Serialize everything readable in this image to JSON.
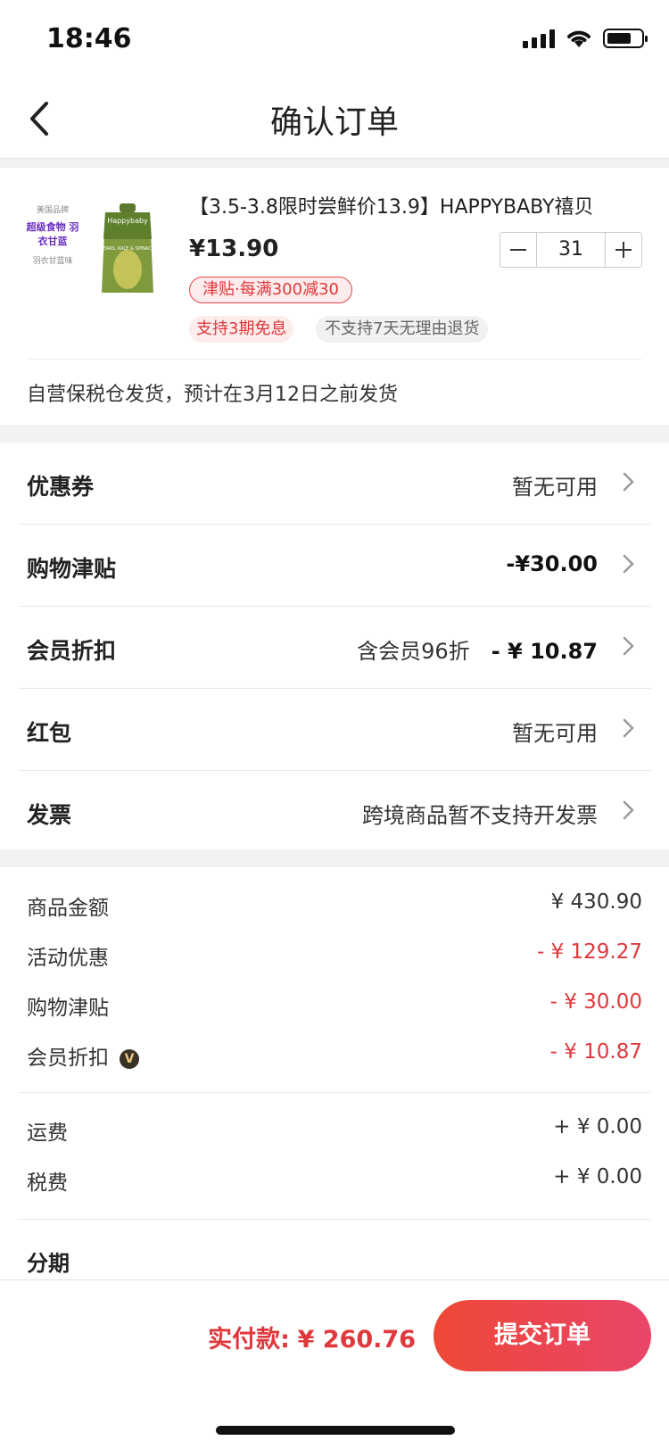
{
  "status_bar": {
    "time": "18:46"
  },
  "nav": {
    "title": "确认订单"
  },
  "product": {
    "image_label_1": "美国品牌",
    "image_label_2": "超级食物 羽衣甘蓝",
    "image_label_3": "羽衣甘蓝味",
    "pouch_brand": "Happybaby",
    "pouch_text": "PEARS, KALE & SPINACH",
    "name": "【3.5-3.8限时尝鲜价13.9】HAPPYBABY禧贝",
    "price": "¥13.90",
    "quantity": "31",
    "subsidy_badge": "津贴·每满300减30",
    "installment_tag": "支持3期免息",
    "return_tag": "不支持7天无理由退货",
    "shipping_note": "自营保税仓发货，预计在3月12日之前发货"
  },
  "options": [
    {
      "label": "优惠券",
      "value": "暂无可用"
    },
    {
      "label": "购物津贴",
      "value": "-¥30.00"
    },
    {
      "label": "会员折扣",
      "sub": "含会员96折",
      "value": "- ¥ 10.87"
    },
    {
      "label": "红包",
      "value": "暂无可用"
    },
    {
      "label": "发票",
      "value": "跨境商品暂不支持开发票"
    }
  ],
  "summary": {
    "goods_amount": {
      "label": "商品金额",
      "value": "¥ 430.90"
    },
    "promotion": {
      "label": "活动优惠",
      "value": "- ¥ 129.27"
    },
    "subsidy": {
      "label": "购物津贴",
      "value": "- ¥ 30.00"
    },
    "member_discount": {
      "label": "会员折扣",
      "value": "- ¥ 10.87",
      "vip_icon": "V"
    },
    "shipping": {
      "label": "运费",
      "value": "+ ¥ 0.00"
    },
    "tax": {
      "label": "税费",
      "value": "+ ¥ 0.00"
    },
    "installment_label": "分期"
  },
  "footer": {
    "pay_label": "实付款:",
    "pay_amount": "¥ 260.76",
    "submit_label": "提交订单"
  },
  "colors": {
    "accent_red": "#e0383c",
    "button_gradient_start": "#ee4836",
    "button_gradient_end": "#e8456a"
  }
}
